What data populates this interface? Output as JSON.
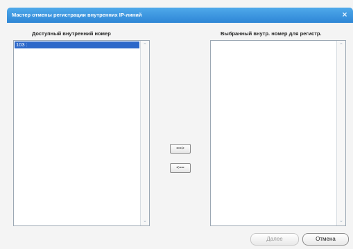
{
  "dialog": {
    "title": "Мастер отмены регистрации внутренних IP-линий",
    "close_icon": "×"
  },
  "available": {
    "label": "Доступный внутренний номер",
    "items": [
      "103 :"
    ]
  },
  "selected": {
    "label": "Выбранный внутр. номер для регистр.",
    "items": []
  },
  "buttons": {
    "add": "==>",
    "remove": "<==",
    "next": "Далее",
    "cancel": "Отмена"
  },
  "icons": {
    "close": "close-icon",
    "scroll_up": "scroll-up-arrow-icon",
    "scroll_down": "scroll-down-arrow-icon"
  },
  "colors": {
    "titlebar": "#2e86d6",
    "selection": "#2d68c9",
    "disabled_text": "#9a9a9a"
  }
}
